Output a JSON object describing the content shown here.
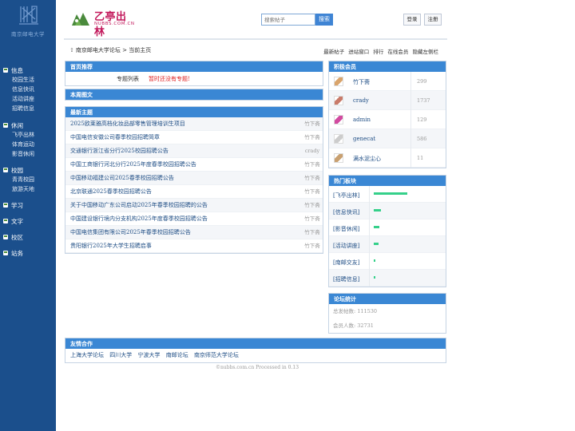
{
  "sidebar": {
    "logo_text": "南京邮电大学",
    "sections": [
      {
        "title": "信息",
        "items": [
          "校园生活",
          "信息快讯",
          "活动讲座",
          "招聘信息"
        ]
      },
      {
        "title": "休闲",
        "items": [
          "飞亭出林",
          "体育运动",
          "影音休闲"
        ]
      },
      {
        "title": "校园",
        "items": [
          "青青校园",
          "旅游天地"
        ]
      },
      {
        "title": "学习",
        "items": []
      },
      {
        "title": "文字",
        "items": []
      },
      {
        "title": "校区",
        "items": []
      },
      {
        "title": "站务",
        "items": []
      }
    ]
  },
  "header": {
    "brand_cn": "乙亭出林",
    "brand_en": "NUBBS.COM.CN",
    "search_placeholder": "搜索帖子",
    "search_button": "搜索",
    "login": "登录",
    "register": "注册"
  },
  "breadcrumb": "南京邮电大学论坛 > 当前主页",
  "top_links": [
    "最新帖子",
    "进站窗口",
    "排行",
    "在线会员",
    "隐藏左侧栏"
  ],
  "recommend": {
    "title": "首页推荐",
    "label": "专题列表",
    "empty": "暂时还没有专题!"
  },
  "weekly_title": "本周图文",
  "latest": {
    "title": "最新主题",
    "rows": [
      {
        "title": "2025欧莱雅高档化妆品部零售管理培训生项目",
        "author": "竹下斋"
      },
      {
        "title": "中国电信安徽公司春季校园招聘简章",
        "author": "竹下斋"
      },
      {
        "title": "交通银行浙江省分行2025校园招聘公告",
        "author": "crady"
      },
      {
        "title": "中国工商银行河北分行2025年度春季校园招聘公告",
        "author": "竹下斋"
      },
      {
        "title": "中国移动福建公司2025春季校园招聘公告",
        "author": "竹下斋"
      },
      {
        "title": "北京联通2025春季校园招聘公告",
        "author": "竹下斋"
      },
      {
        "title": "关于中国移动广东公司启动2025年春季校园招聘的公告",
        "author": "竹下斋"
      },
      {
        "title": "中国建设银行境内分支机构2025年度春季校园招聘公告",
        "author": "竹下斋"
      },
      {
        "title": "中国电信集团有限公司2025年春季校园招聘公告",
        "author": "竹下斋"
      },
      {
        "title": "贵阳银行2025年大学生招聘启事",
        "author": "竹下斋"
      }
    ]
  },
  "members": {
    "title": "积极会员",
    "rows": [
      {
        "name": "竹下斋",
        "count": "299",
        "avatar_color": "#d9a46b"
      },
      {
        "name": "crady",
        "count": "1737",
        "avatar_color": "#c97b6a"
      },
      {
        "name": "admin",
        "count": "129",
        "avatar_color": "#d24aa0"
      },
      {
        "name": "genecat",
        "count": "586",
        "avatar_color": "#cccccc"
      },
      {
        "name": "满水泥尘心",
        "count": "11",
        "avatar_color": "#c9a070"
      }
    ]
  },
  "hot_boards": {
    "title": "热门板块",
    "rows": [
      {
        "name": "[飞亭出林]",
        "level": 0.52
      },
      {
        "name": "[信息快讯]",
        "level": 0.11
      },
      {
        "name": "[影音休闲]",
        "level": 0.09
      },
      {
        "name": "[活动讲座]",
        "level": 0.08
      },
      {
        "name": "[南邮交友]",
        "level": 0.03
      },
      {
        "name": "[招聘信息]",
        "level": 0.02
      }
    ]
  },
  "stats": {
    "title": "论坛统计",
    "posts": "总发帖数: 111530",
    "members": "会员人数: 32731"
  },
  "friends": {
    "title": "友情合作",
    "links": [
      "上海大学论坛",
      "四川大学",
      "宁波大学",
      "南邮论坛",
      "南京师范大学论坛"
    ]
  },
  "footer": "©nubbs.com.cn  Processed in 0.13"
}
